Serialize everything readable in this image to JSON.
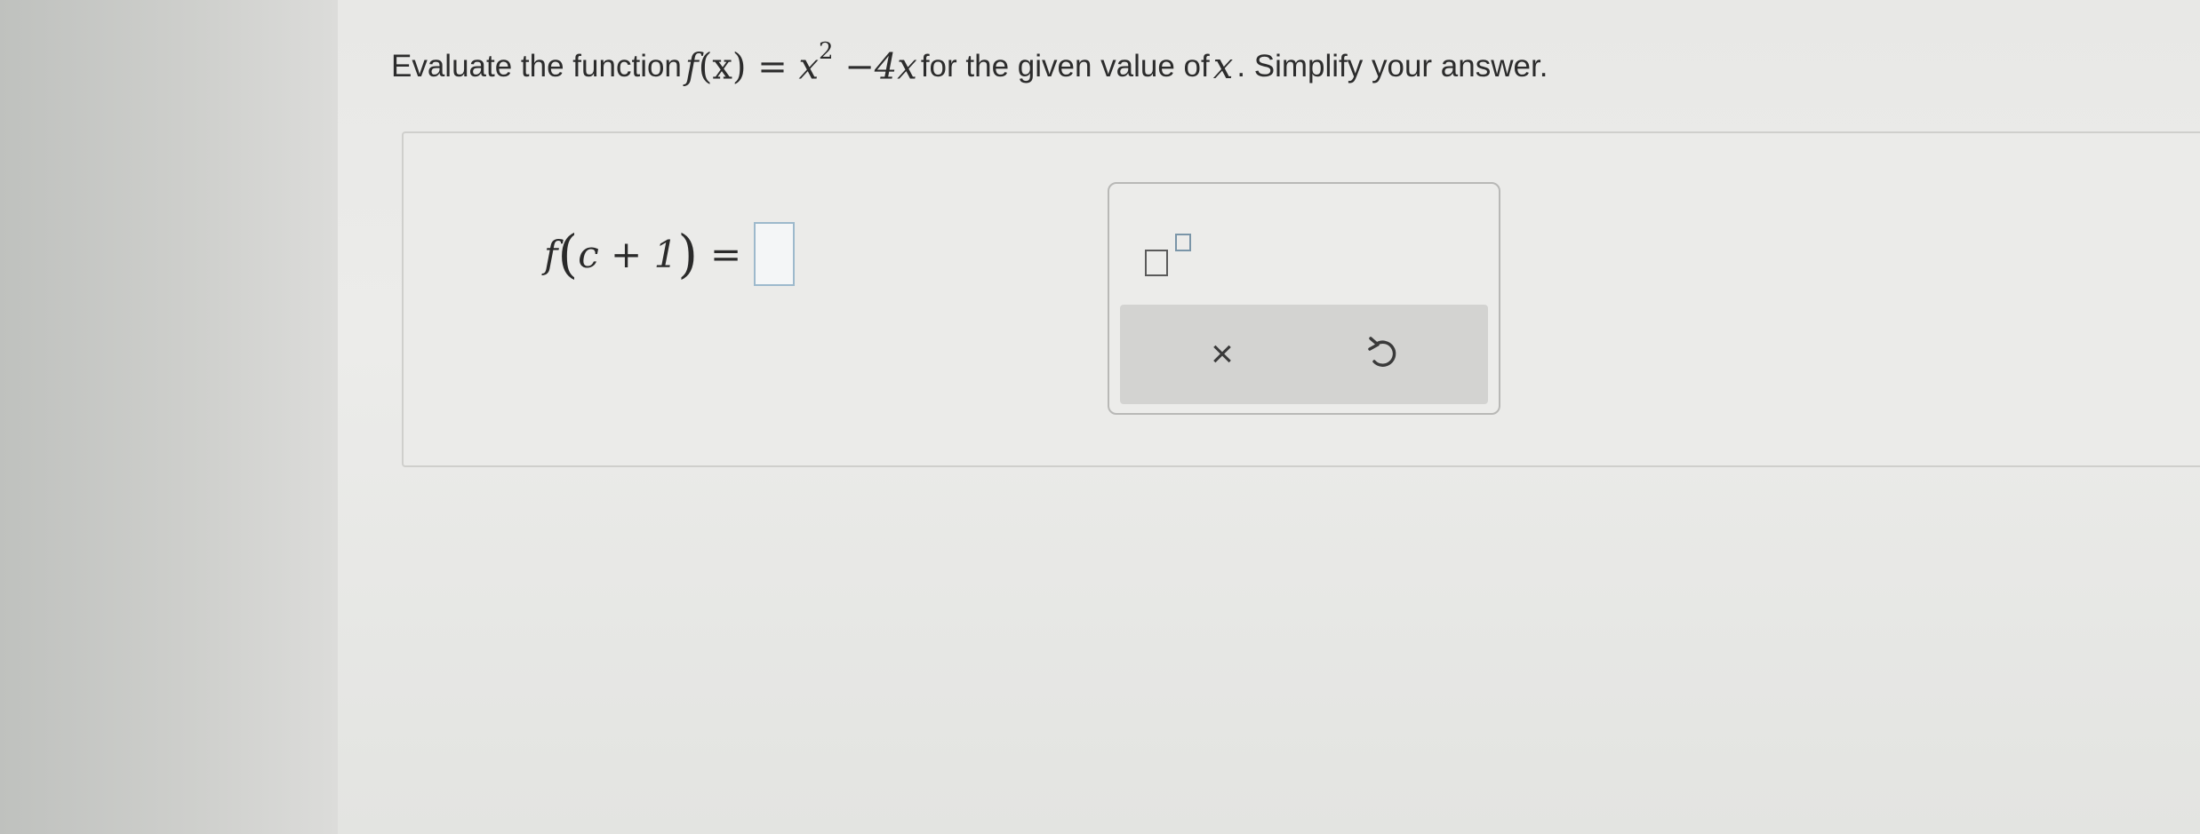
{
  "question": {
    "prefix": "Evaluate the function",
    "func_name": "f",
    "func_arg": "(x)",
    "equals": "=",
    "base": "x",
    "exponent": "2",
    "rest": "−4x",
    "suffix_1": "for the given value of",
    "variable": "x",
    "suffix_2": ". Simplify your answer."
  },
  "answer": {
    "func_name": "f",
    "open_paren": "(",
    "arg": "c + 1",
    "close_paren": ")",
    "equals": "=",
    "value": ""
  },
  "toolbox": {
    "clear_symbol": "×",
    "icons": {
      "superscript": "superscript-icon",
      "clear": "close-icon",
      "undo": "undo-icon"
    }
  }
}
